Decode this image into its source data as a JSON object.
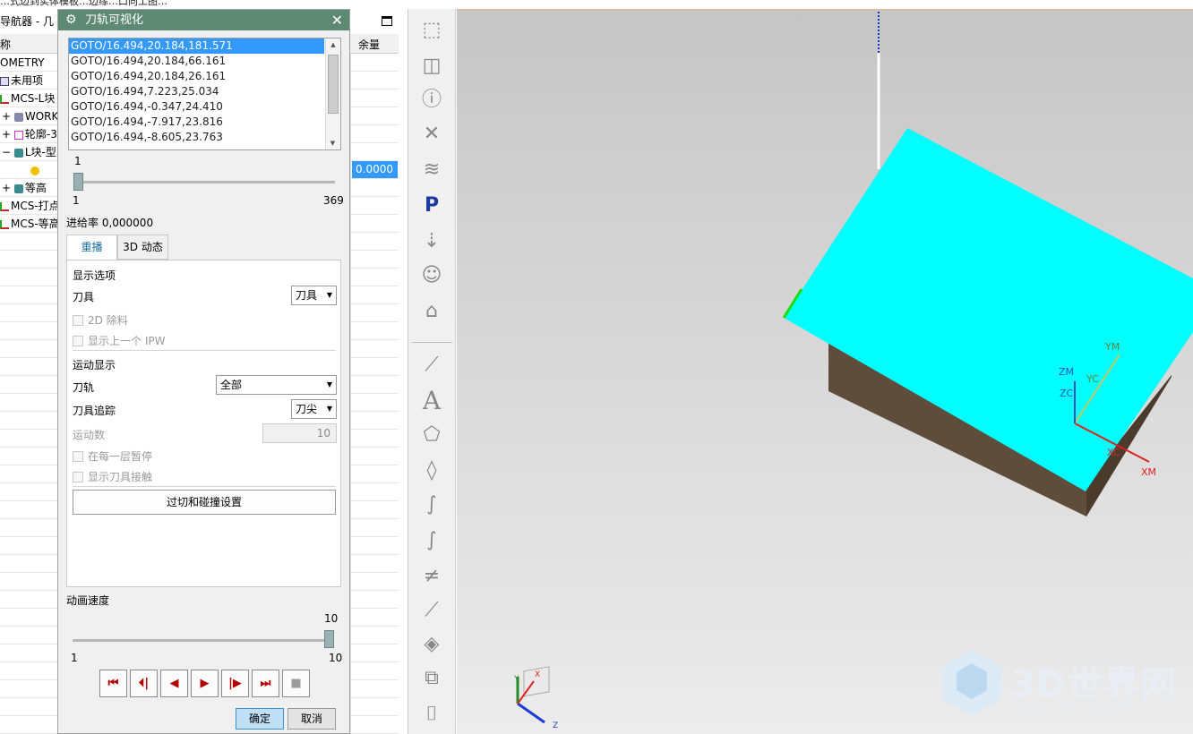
{
  "navigator": {
    "crumb": "…式边到实体模板…边缘…口向工图…",
    "title": "导航器 - 几",
    "col_name": "称",
    "col_stock": "余量",
    "selected_value": "0.0000",
    "tree": [
      {
        "label": "OMETRY"
      },
      {
        "label": "未用项"
      },
      {
        "label": "MCS-L块"
      },
      {
        "label": "WORK"
      },
      {
        "label": "轮廓-3"
      },
      {
        "label": "L块-型"
      },
      {
        "label": ""
      },
      {
        "label": "等高"
      },
      {
        "label": "MCS-打点"
      },
      {
        "label": "MCS-等高"
      }
    ]
  },
  "dialog": {
    "title": "刀轨可视化",
    "path_list": [
      "GOTO/16.494,20.184,181.571",
      "GOTO/16.494,20.184,66.161",
      "GOTO/16.494,20.184,26.161",
      "GOTO/16.494,7.223,25.034",
      "GOTO/16.494,-0.347,24.410",
      "GOTO/16.494,-7.917,23.816",
      "GOTO/16.494,-8.605,23.763"
    ],
    "slider_current": "1",
    "slider_min": "1",
    "slider_max": "369",
    "slider_position": 0.0,
    "feedrate": "进给率 0,000000",
    "tabs": [
      "重播",
      "3D 动态"
    ],
    "display_options": "显示选项",
    "tool_label": "刀具",
    "tool_value": "刀具",
    "cb_2d": "2D 除料",
    "cb_prev_ipw": "显示上一个 IPW",
    "motion_display": "运动显示",
    "path_label": "刀轨",
    "path_value": "全部",
    "trace_label": "刀具追踪",
    "trace_value": "刀尖",
    "motion_count_label": "运动数",
    "motion_count_value": "10",
    "cb_pause": "在每一层暂停",
    "cb_contact": "显示刀具接触",
    "gouge_button": "过切和碰撞设置",
    "speed_label": "动画速度",
    "speed_current": "10",
    "speed_min": "1",
    "speed_max": "10",
    "speed_position": 1.0,
    "ok": "确定",
    "cancel": "取消",
    "playback": [
      "⏮",
      "⏴|",
      "◀",
      "▶",
      "|▶",
      "⏭",
      "■"
    ]
  },
  "viewport": {
    "axes": {
      "ym": "YM",
      "yc": "YC",
      "zm": "ZM",
      "zc": "ZC",
      "xc": "XC",
      "xm": "XM"
    },
    "triad": {
      "x": "X",
      "y": "Y",
      "z": "Z"
    },
    "colors": {
      "top_face": "#00ffff",
      "side_face": "#5e4d3b",
      "edge": "#22dd00"
    }
  },
  "watermark": {
    "brand": "3D世界网",
    "url": "WWW.3DSJW.COM"
  }
}
